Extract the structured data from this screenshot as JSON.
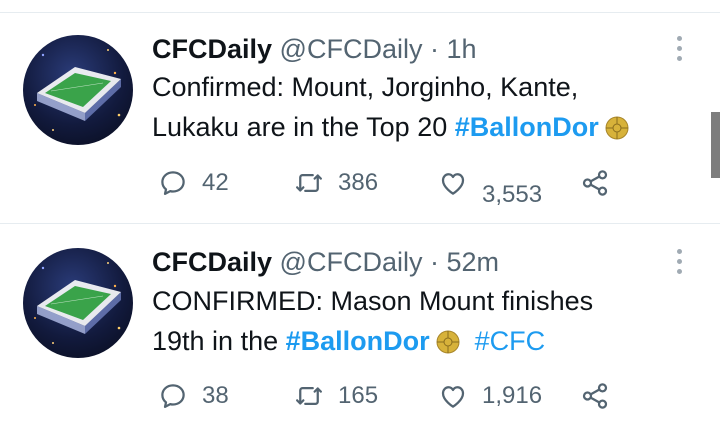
{
  "tweets": [
    {
      "display_name": "CFCDaily",
      "handle": "@CFCDaily",
      "separator": "·",
      "time": "1h",
      "text_line1": "Confirmed: Mount, Jorginho, Kante,",
      "text_line2": "Lukaku are in the Top 20 ",
      "hashtag1": "#BallonDor",
      "hashtag2": "",
      "replies": "42",
      "retweets": "386",
      "likes": "3,553"
    },
    {
      "display_name": "CFCDaily",
      "handle": "@CFCDaily",
      "separator": "·",
      "time": "52m",
      "text_line1": "CONFIRMED: Mason Mount finishes",
      "text_line2": "19th in the ",
      "hashtag1": "#BallonDor",
      "hashtag2": "#CFC",
      "replies": "38",
      "retweets": "165",
      "likes": "1,916"
    }
  ],
  "icons": {
    "reply": "reply-icon",
    "retweet": "retweet-icon",
    "like": "heart-icon",
    "share": "share-icon",
    "more": "more-vertical-icon",
    "ball": "golden-ball-emoji"
  },
  "colors": {
    "hashtag": "#1d9bf0",
    "text": "#0f1419",
    "muted": "#536471",
    "divider": "#e6ecf0"
  }
}
